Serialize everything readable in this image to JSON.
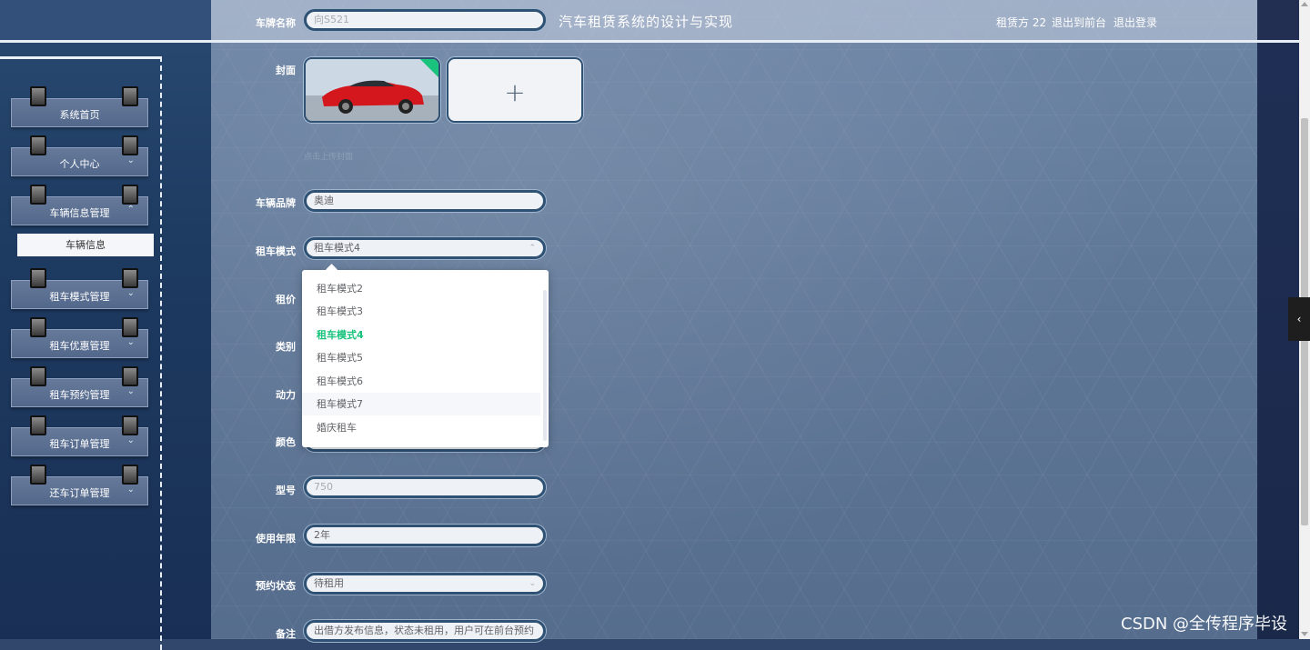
{
  "header": {
    "site_title": "汽车租赁系统的设计与实现",
    "user": "租赁方 22",
    "front_link": "退出到前台",
    "logout_link": "退出登录"
  },
  "sidebar": {
    "items": [
      {
        "label": "系统首页"
      },
      {
        "label": "个人中心"
      },
      {
        "label": "车辆信息管理"
      },
      {
        "label": "租车模式管理"
      },
      {
        "label": "租车优惠管理"
      },
      {
        "label": "租车预约管理"
      },
      {
        "label": "租车订单管理"
      },
      {
        "label": "还车订单管理"
      }
    ],
    "submenu_active": "车辆信息"
  },
  "form": {
    "plate_label": "车牌名称",
    "plate_value": "向S521",
    "cover_label": "封面",
    "upload_tip": "点击上传封面",
    "brand_label": "车辆品牌",
    "brand_value": "奥迪",
    "mode_label": "租车模式",
    "mode_value": "租车模式4",
    "price_label": "租价",
    "category_label": "类别",
    "power_label": "动力",
    "color_label": "颜色",
    "model_label": "型号",
    "model_value": "750",
    "years_label": "使用年限",
    "years_value": "2年",
    "status_label": "预约状态",
    "status_value": "待租用",
    "remark_label": "备注",
    "remark_value": "出借方发布信息，状态未租用，用户可在前台预约"
  },
  "dropdown": {
    "options": [
      "租车模式2",
      "租车模式3",
      "租车模式4",
      "租车模式5",
      "租车模式6",
      "租车模式7",
      "婚庆租车"
    ],
    "selected": "租车模式4",
    "hovered": "租车模式7"
  },
  "icons": {
    "add_cover": "plus-icon",
    "chevron": "chevron-down-icon",
    "collapse": "chevron-left-icon"
  },
  "watermark": "CSDN @全传程序毕设",
  "colors": {
    "accent": "#19c37d",
    "sidebar": "#1d3a60",
    "main_bg": "#5f7797"
  }
}
